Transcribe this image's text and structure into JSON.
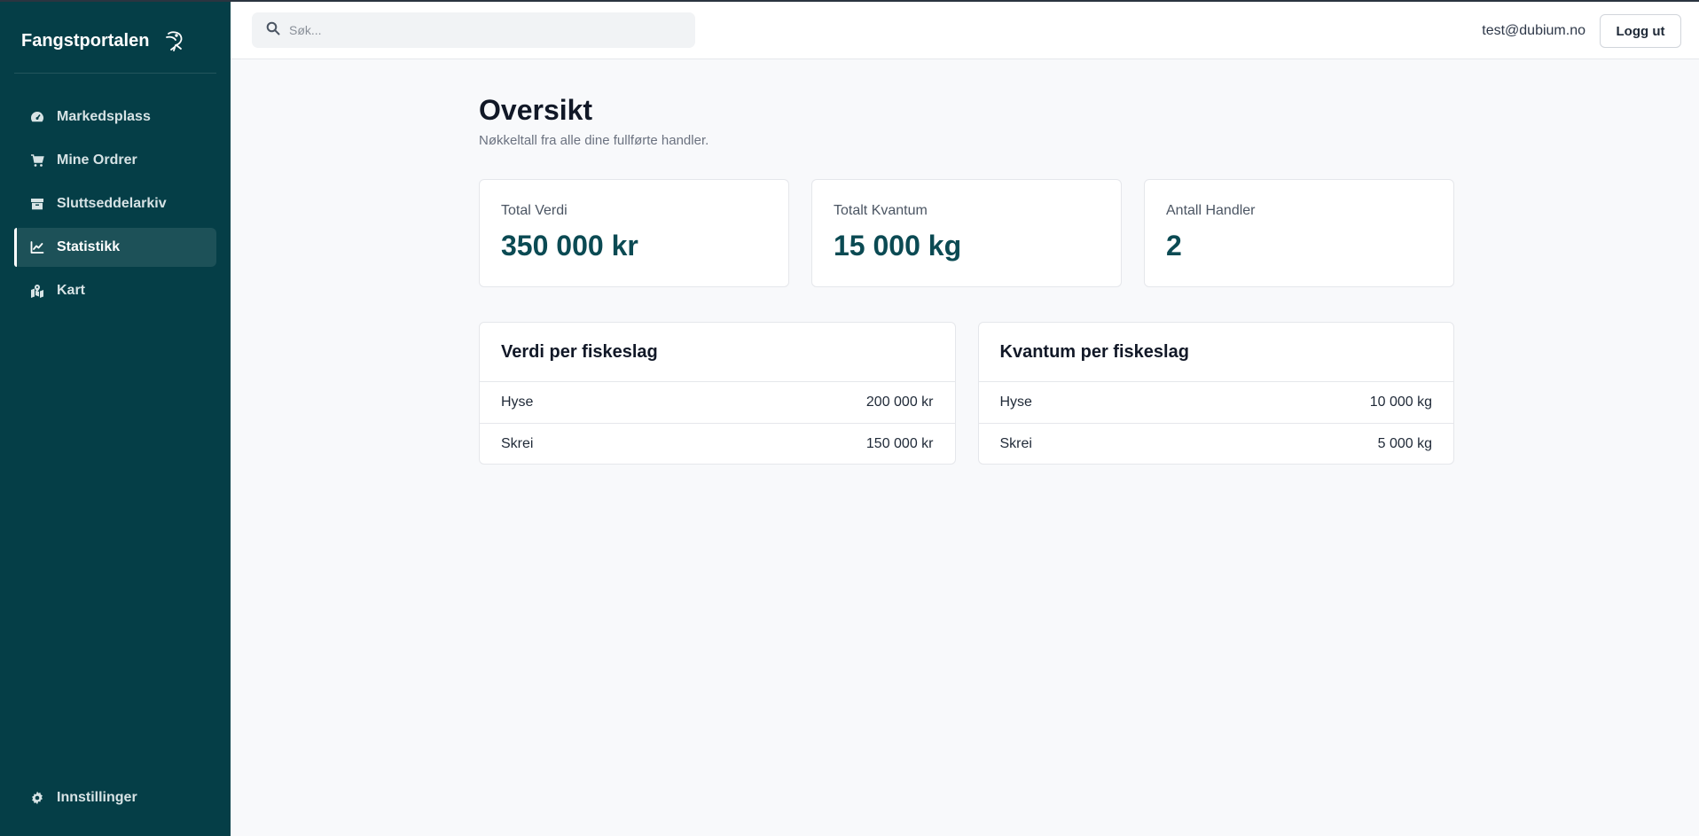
{
  "brand": {
    "name": "Fangstportalen",
    "logo_icon": "fish-icon"
  },
  "sidebar": {
    "items": [
      {
        "label": "Markedsplass",
        "icon": "dashboard-icon",
        "active": false
      },
      {
        "label": "Mine Ordrer",
        "icon": "cart-icon",
        "active": false
      },
      {
        "label": "Sluttseddelarkiv",
        "icon": "archive-icon",
        "active": false
      },
      {
        "label": "Statistikk",
        "icon": "chart-line-icon",
        "active": true
      },
      {
        "label": "Kart",
        "icon": "map-icon",
        "active": false
      }
    ],
    "settings": {
      "label": "Innstillinger",
      "icon": "gear-icon"
    }
  },
  "topbar": {
    "search_placeholder": "Søk...",
    "user_email": "test@dubium.no",
    "logout_label": "Logg ut"
  },
  "main": {
    "title": "Oversikt",
    "subtitle": "Nøkkeltall fra alle dine fullførte handler.",
    "stats": [
      {
        "label": "Total Verdi",
        "value": "350 000 kr"
      },
      {
        "label": "Totalt Kvantum",
        "value": "15 000 kg"
      },
      {
        "label": "Antall Handler",
        "value": "2"
      }
    ],
    "tables": [
      {
        "title": "Verdi per fiskeslag",
        "rows": [
          {
            "name": "Hyse",
            "value": "200 000 kr"
          },
          {
            "name": "Skrei",
            "value": "150 000 kr"
          }
        ]
      },
      {
        "title": "Kvantum per fiskeslag",
        "rows": [
          {
            "name": "Hyse",
            "value": "10 000 kg"
          },
          {
            "name": "Skrei",
            "value": "5 000 kg"
          }
        ]
      }
    ]
  },
  "colors": {
    "sidebar_bg": "#053e47",
    "sidebar_active": "#1d5158",
    "accent_value": "#0b4a53"
  }
}
